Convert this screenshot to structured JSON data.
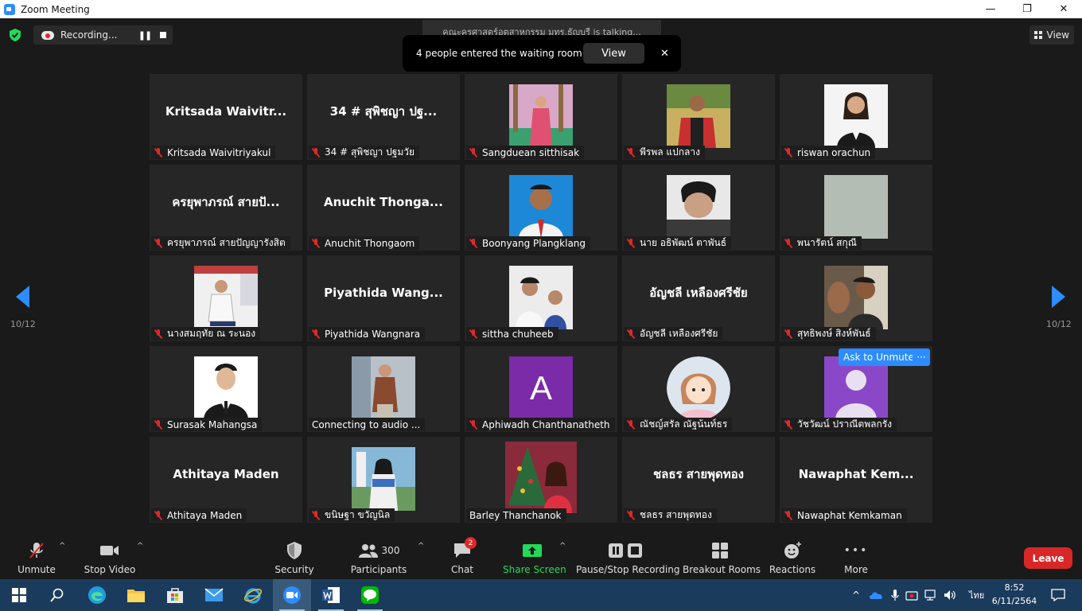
{
  "window": {
    "title": "Zoom Meeting",
    "controls": {
      "minimize": "—",
      "maximize": "❐",
      "close": "✕"
    }
  },
  "recording": {
    "label": "Recording...",
    "pause": "❚❚"
  },
  "view_button": {
    "label": "View"
  },
  "talking_banner": "คณะครุศาสตร์อุตสาหกรรม มทร.ธัญบุรี is talking...",
  "waiting_popup": {
    "text": "4 people entered the waiting room",
    "view_label": "View",
    "close": "✕"
  },
  "pagination": {
    "left": "10/12",
    "right": "10/12"
  },
  "participants": [
    {
      "big": "Kritsada  Waivitr...",
      "name": "Kritsada Waivitriyakul",
      "muted": true
    },
    {
      "big": "34 # สุพิชญา ปฐ...",
      "name": "34 # สุพิชญา ปฐมวัย",
      "muted": true
    },
    {
      "photo": "photo1",
      "name": "Sangduean sitthisak",
      "muted": true
    },
    {
      "photo": "photo2",
      "name": "พีรพล แปกลาง",
      "muted": true
    },
    {
      "photo": "photo3",
      "name": "riswan orachun",
      "muted": true
    },
    {
      "big": "ครยุพาภรณ์ สายปั...",
      "name": "ครยุพาภรณ์ สายปัญญารังสิต",
      "muted": true
    },
    {
      "big": "Anuchit  Thonga...",
      "name": "Anuchit Thongaom",
      "muted": true
    },
    {
      "photo": "photo4",
      "name": "Boonyang Plangklang",
      "muted": true
    },
    {
      "photo": "photo5",
      "name": "นาย อธิพัฒน์ ตาพันธ์",
      "muted": true
    },
    {
      "photo": "photo6",
      "name": "พนารัตน์ สกุณี",
      "muted": true
    },
    {
      "photo": "photo7",
      "name": "นางสมฤทัย ณ ระนอง",
      "muted": true
    },
    {
      "big": "Piyathida  Wang...",
      "name": "Piyathida Wangnara",
      "muted": true
    },
    {
      "photo": "photo8",
      "name": "sittha chuheeb",
      "muted": true
    },
    {
      "big": "อัญชลี เหลืองศรีชัย",
      "name": "อัญชลี เหลืองศรีชัย",
      "muted": true
    },
    {
      "photo": "photo9",
      "name": "สุทธิพงษ์ สิงห์พันธ์",
      "muted": true
    },
    {
      "photo": "photo10",
      "name": "Surasak Mahangsa",
      "muted": true
    },
    {
      "photo": "photo11",
      "name": "Connecting to audio ...",
      "muted": false
    },
    {
      "letter": "A",
      "name": "Aphiwadh Chanthanatheth",
      "muted": true
    },
    {
      "photo": "avatar-cartoon",
      "name": "ณัชญ์สรัล ณัฐน้นท์ธร",
      "muted": true
    },
    {
      "photo": "avatar-default",
      "name": "วัชวัฒน์ ปราณีตพลกรัง",
      "muted": true
    },
    {
      "big": "Athitaya Maden",
      "name": "Athitaya Maden",
      "muted": true
    },
    {
      "photo": "photo12",
      "name": "ขนิษฐา ขวัญนิล",
      "muted": true
    },
    {
      "photo": "photo13",
      "name": "Barley Thanchanok",
      "muted": false
    },
    {
      "big": "ชลธร สายพุดทอง",
      "name": "ชลธร สายพุดทอง",
      "muted": true
    },
    {
      "big": "Nawaphat  Kem...",
      "name": "Nawaphat Kemkaman",
      "muted": true
    }
  ],
  "hover_controls": {
    "ask_unmute": "Ask to Unmute",
    "more": "···"
  },
  "toolbar": {
    "unmute": "Unmute",
    "stop_video": "Stop Video",
    "security": "Security",
    "participants": "Participants",
    "participants_count": "300",
    "chat": "Chat",
    "chat_badge": "2",
    "share_screen": "Share Screen",
    "pause_stop_recording": "Pause/Stop Recording",
    "breakout_rooms": "Breakout Rooms",
    "reactions": "Reactions",
    "more": "More",
    "leave": "Leave",
    "caret": "^",
    "more_dots": "•••"
  },
  "taskbar": {
    "language": "ไทย",
    "time": "8:52",
    "date": "6/11/2564",
    "tray_up": "^"
  },
  "colors": {
    "accent": "#2d8cff",
    "leave": "#d92727",
    "share": "#23d959",
    "muted_icon": "#e02828",
    "letter_avatar": "#7b2aa8"
  }
}
